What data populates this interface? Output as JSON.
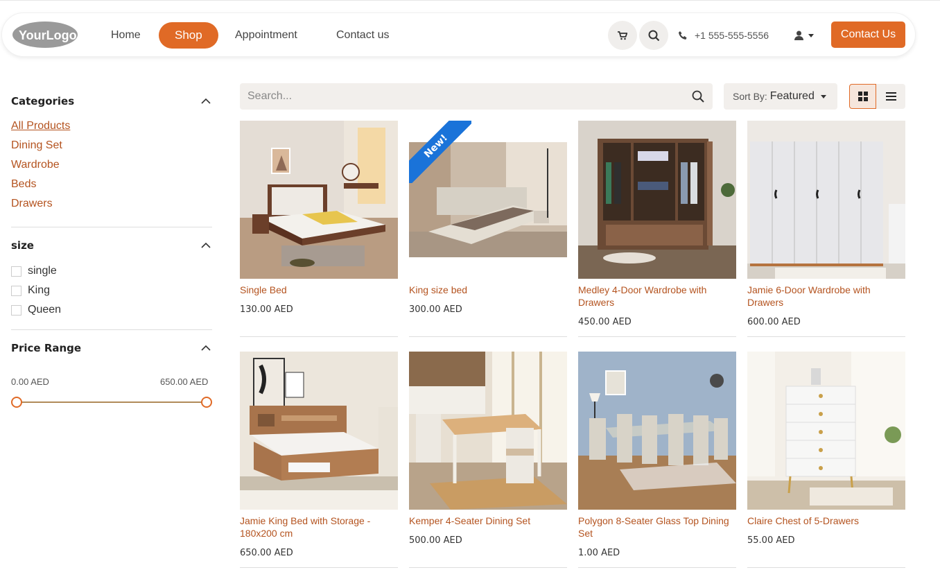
{
  "header": {
    "logo_text": "YourLogo",
    "nav": [
      "Home",
      "Shop",
      "Appointment",
      "Contact us"
    ],
    "phone": "+1 555-555-5556",
    "contact_button": "Contact Us"
  },
  "sidebar": {
    "categories_title": "Categories",
    "categories": [
      "All Products",
      "Dining Set",
      "Wardrobe",
      "Beds",
      "Drawers"
    ],
    "size_title": "size",
    "sizes": [
      "single",
      "King",
      "Queen"
    ],
    "price_title": "Price Range",
    "price_min": "0.00 AED",
    "price_max": "650.00 AED"
  },
  "toolbar": {
    "search_placeholder": "Search...",
    "sort_label": "Sort By:",
    "sort_value": "Featured"
  },
  "products": [
    {
      "name": "Single Bed",
      "price": "130.00 AED"
    },
    {
      "name": "King size bed",
      "price": "300.00 AED",
      "badge": "New!"
    },
    {
      "name": "Medley 4-Door Wardrobe with Drawers",
      "price": "450.00 AED"
    },
    {
      "name": "Jamie 6-Door Wardrobe with Drawers",
      "price": "600.00 AED"
    },
    {
      "name": "Jamie King Bed with Storage - 180x200 cm",
      "price": "650.00 AED"
    },
    {
      "name": "Kemper 4-Seater Dining Set",
      "price": "500.00 AED"
    },
    {
      "name": "Polygon 8-Seater Glass Top Dining Set",
      "price": "1.00 AED"
    },
    {
      "name": "Claire Chest of 5-Drawers",
      "price": "55.00 AED"
    }
  ],
  "colors": {
    "accent": "#e06a26",
    "link": "#b4531f",
    "badge": "#1a73d9"
  }
}
